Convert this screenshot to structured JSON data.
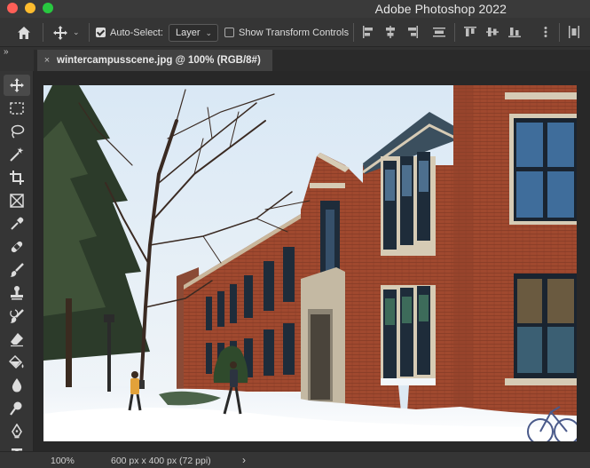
{
  "window": {
    "app_title": "Adobe Photoshop 2022",
    "traffic_lights": [
      "close",
      "minimize",
      "zoom"
    ]
  },
  "options_bar": {
    "home_icon": "home-icon",
    "move_icon": "move-icon",
    "auto_select_label": "Auto-Select:",
    "auto_select_checked": true,
    "layer_dropdown": "Layer",
    "show_transform_label": "Show Transform Controls",
    "show_transform_checked": false,
    "align_icons": [
      "align-left-icon",
      "align-horizontal-center-icon",
      "align-right-icon",
      "distribute-vertical-icon",
      "align-top-icon",
      "align-vertical-center-icon",
      "align-bottom-icon",
      "more-icon"
    ]
  },
  "document_tab": {
    "close_glyph": "×",
    "title": "wintercampusscene.jpg @ 100% (RGB/8#)"
  },
  "tools": [
    {
      "name": "move-tool",
      "icon": "move-icon",
      "active": true
    },
    {
      "name": "marquee-tool",
      "icon": "rectangle-marquee-icon"
    },
    {
      "name": "lasso-tool",
      "icon": "lasso-icon"
    },
    {
      "name": "quick-selection-tool",
      "icon": "magic-wand-icon"
    },
    {
      "name": "crop-tool",
      "icon": "crop-icon"
    },
    {
      "name": "frame-tool",
      "icon": "frame-icon"
    },
    {
      "name": "eyedropper-tool",
      "icon": "eyedropper-icon"
    },
    {
      "name": "healing-brush-tool",
      "icon": "bandage-icon"
    },
    {
      "name": "brush-tool",
      "icon": "brush-icon"
    },
    {
      "name": "clone-stamp-tool",
      "icon": "stamp-icon"
    },
    {
      "name": "history-brush-tool",
      "icon": "history-brush-icon"
    },
    {
      "name": "eraser-tool",
      "icon": "eraser-icon"
    },
    {
      "name": "paint-bucket-tool",
      "icon": "paint-bucket-icon"
    },
    {
      "name": "blur-tool",
      "icon": "droplet-icon"
    },
    {
      "name": "dodge-tool",
      "icon": "dodge-icon"
    },
    {
      "name": "pen-tool",
      "icon": "pen-icon"
    },
    {
      "name": "type-tool",
      "icon": "type-icon",
      "glyph": "T"
    }
  ],
  "status_bar": {
    "zoom": "100%",
    "doc_info": "600 px x 400 px (72 ppi)",
    "arrow": "›"
  },
  "colors": {
    "panel": "#353535",
    "canvas_bg": "#282828",
    "tab_active": "#424242",
    "text": "#dcdcdc"
  }
}
